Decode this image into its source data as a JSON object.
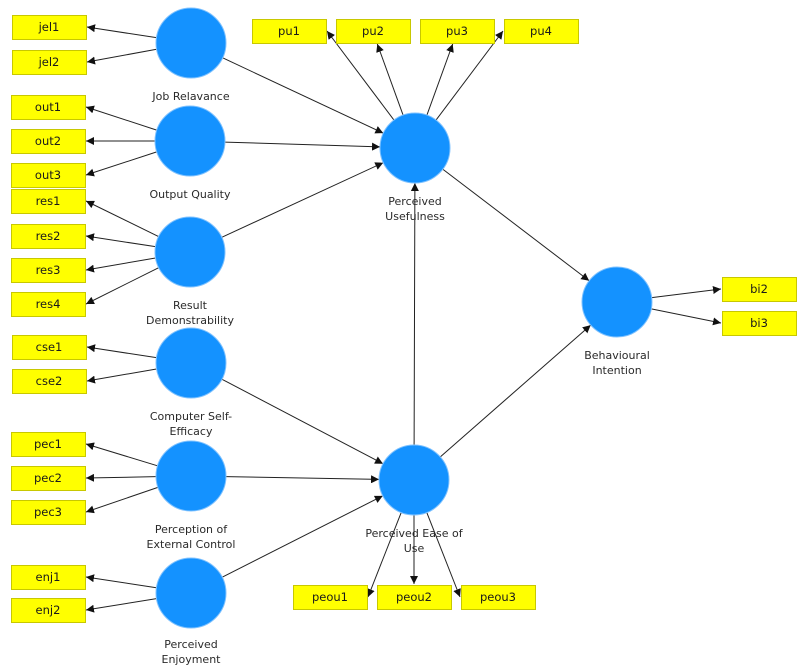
{
  "diagram": {
    "type": "structural-equation-model",
    "colors": {
      "construct_fill": "#1492ff",
      "indicator_fill": "#ffff00",
      "indicator_border": "#c8c800",
      "edge": "#222222"
    },
    "constructs": [
      {
        "id": "JR",
        "label_lines": [
          "Job Relavance"
        ]
      },
      {
        "id": "OQ",
        "label_lines": [
          "Output Quality"
        ]
      },
      {
        "id": "RD",
        "label_lines": [
          "Result",
          "Demonstrability"
        ]
      },
      {
        "id": "CSE",
        "label_lines": [
          "Computer Self-",
          "Efficacy"
        ]
      },
      {
        "id": "PEC",
        "label_lines": [
          "Perception of",
          "External Control"
        ]
      },
      {
        "id": "ENJ",
        "label_lines": [
          "Perceived",
          "Enjoyment"
        ]
      },
      {
        "id": "PU",
        "label_lines": [
          "Perceived",
          "Usefulness"
        ]
      },
      {
        "id": "PEOU",
        "label_lines": [
          "Perceived Ease of",
          "Use"
        ]
      },
      {
        "id": "BI",
        "label_lines": [
          "Behavioural",
          "Intention"
        ]
      }
    ],
    "indicators": [
      {
        "id": "jel1",
        "label": "jel1",
        "construct": "JR"
      },
      {
        "id": "jel2",
        "label": "jel2",
        "construct": "JR"
      },
      {
        "id": "out1",
        "label": "out1",
        "construct": "OQ"
      },
      {
        "id": "out2",
        "label": "out2",
        "construct": "OQ"
      },
      {
        "id": "out3",
        "label": "out3",
        "construct": "OQ"
      },
      {
        "id": "res1",
        "label": "res1",
        "construct": "RD"
      },
      {
        "id": "res2",
        "label": "res2",
        "construct": "RD"
      },
      {
        "id": "res3",
        "label": "res3",
        "construct": "RD"
      },
      {
        "id": "res4",
        "label": "res4",
        "construct": "RD"
      },
      {
        "id": "cse1",
        "label": "cse1",
        "construct": "CSE"
      },
      {
        "id": "cse2",
        "label": "cse2",
        "construct": "CSE"
      },
      {
        "id": "pec1",
        "label": "pec1",
        "construct": "PEC"
      },
      {
        "id": "pec2",
        "label": "pec2",
        "construct": "PEC"
      },
      {
        "id": "pec3",
        "label": "pec3",
        "construct": "PEC"
      },
      {
        "id": "enj1",
        "label": "enj1",
        "construct": "ENJ"
      },
      {
        "id": "enj2",
        "label": "enj2",
        "construct": "ENJ"
      },
      {
        "id": "pu1",
        "label": "pu1",
        "construct": "PU"
      },
      {
        "id": "pu2",
        "label": "pu2",
        "construct": "PU"
      },
      {
        "id": "pu3",
        "label": "pu3",
        "construct": "PU"
      },
      {
        "id": "pu4",
        "label": "pu4",
        "construct": "PU"
      },
      {
        "id": "peou1",
        "label": "peou1",
        "construct": "PEOU"
      },
      {
        "id": "peou2",
        "label": "peou2",
        "construct": "PEOU"
      },
      {
        "id": "peou3",
        "label": "peou3",
        "construct": "PEOU"
      },
      {
        "id": "bi2",
        "label": "bi2",
        "construct": "BI"
      },
      {
        "id": "bi3",
        "label": "bi3",
        "construct": "BI"
      }
    ],
    "structural_paths": [
      {
        "from": "JR",
        "to": "PU"
      },
      {
        "from": "OQ",
        "to": "PU"
      },
      {
        "from": "RD",
        "to": "PU"
      },
      {
        "from": "CSE",
        "to": "PEOU"
      },
      {
        "from": "PEC",
        "to": "PEOU"
      },
      {
        "from": "ENJ",
        "to": "PEOU"
      },
      {
        "from": "PEOU",
        "to": "PU"
      },
      {
        "from": "PU",
        "to": "BI"
      },
      {
        "from": "PEOU",
        "to": "BI"
      }
    ]
  }
}
